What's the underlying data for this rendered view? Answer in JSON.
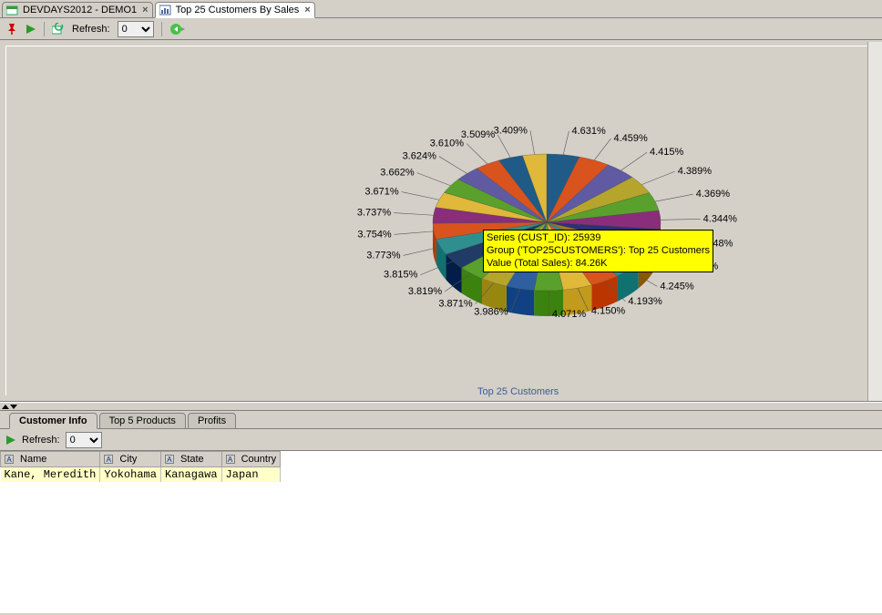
{
  "tabs": [
    {
      "label": "DEVDAYS2012 - DEMO1",
      "icon": "sql-icon"
    },
    {
      "label": "Top 25  Customers By Sales",
      "icon": "report-icon"
    }
  ],
  "toolbar": {
    "refresh_label": "Refresh:",
    "refresh_value": "0"
  },
  "chart_data": {
    "type": "pie",
    "title": "Top 25 Customers",
    "slices": [
      {
        "pct": 4.631,
        "color": "#1f5b86"
      },
      {
        "pct": 4.459,
        "color": "#d9531e"
      },
      {
        "pct": 4.415,
        "color": "#5f5aa2"
      },
      {
        "pct": 4.389,
        "color": "#b5a52c"
      },
      {
        "pct": 4.369,
        "color": "#5aa02c"
      },
      {
        "pct": 4.344,
        "color": "#8a2d7a"
      },
      {
        "pct": 4.248,
        "color": "#2f2f7a"
      },
      {
        "pct": 4.246,
        "color": "#a8761f"
      },
      {
        "pct": 4.245,
        "color": "#2f8f8f"
      },
      {
        "pct": 4.193,
        "color": "#d9531e"
      },
      {
        "pct": 4.15,
        "color": "#e0b83a"
      },
      {
        "pct": 4.071,
        "color": "#5aa02c"
      },
      {
        "pct": 3.986,
        "color": "#2f5fa0"
      },
      {
        "pct": 3.871,
        "color": "#b5a52c"
      },
      {
        "pct": 3.819,
        "color": "#5aa02c"
      },
      {
        "pct": 3.815,
        "color": "#1f3b66"
      },
      {
        "pct": 3.773,
        "color": "#2f8f8f"
      },
      {
        "pct": 3.754,
        "color": "#d9531e"
      },
      {
        "pct": 3.737,
        "color": "#8a2d7a"
      },
      {
        "pct": 3.671,
        "color": "#e0b83a"
      },
      {
        "pct": 3.662,
        "color": "#5aa02c"
      },
      {
        "pct": 3.624,
        "color": "#5f5aa2"
      },
      {
        "pct": 3.61,
        "color": "#d9531e"
      },
      {
        "pct": 3.509,
        "color": "#1f5b86"
      },
      {
        "pct": 3.409,
        "color": "#e0b83a"
      }
    ],
    "tooltip": {
      "line1": "Series (CUST_ID): 25939",
      "line2": "Group ('TOP25CUSTOMERS'): Top 25 Customers",
      "line3": "Value (Total Sales): 84.26K"
    }
  },
  "lower": {
    "tabs": [
      "Customer Info",
      "Top 5 Products",
      "Profits"
    ],
    "refresh_label": "Refresh:",
    "refresh_value": "0",
    "columns": [
      "Name",
      "City",
      "State",
      "Country"
    ],
    "rows": [
      {
        "name": "Kane, Meredith",
        "city": "Yokohama",
        "state": "Kanagawa",
        "country": "Japan"
      }
    ]
  }
}
